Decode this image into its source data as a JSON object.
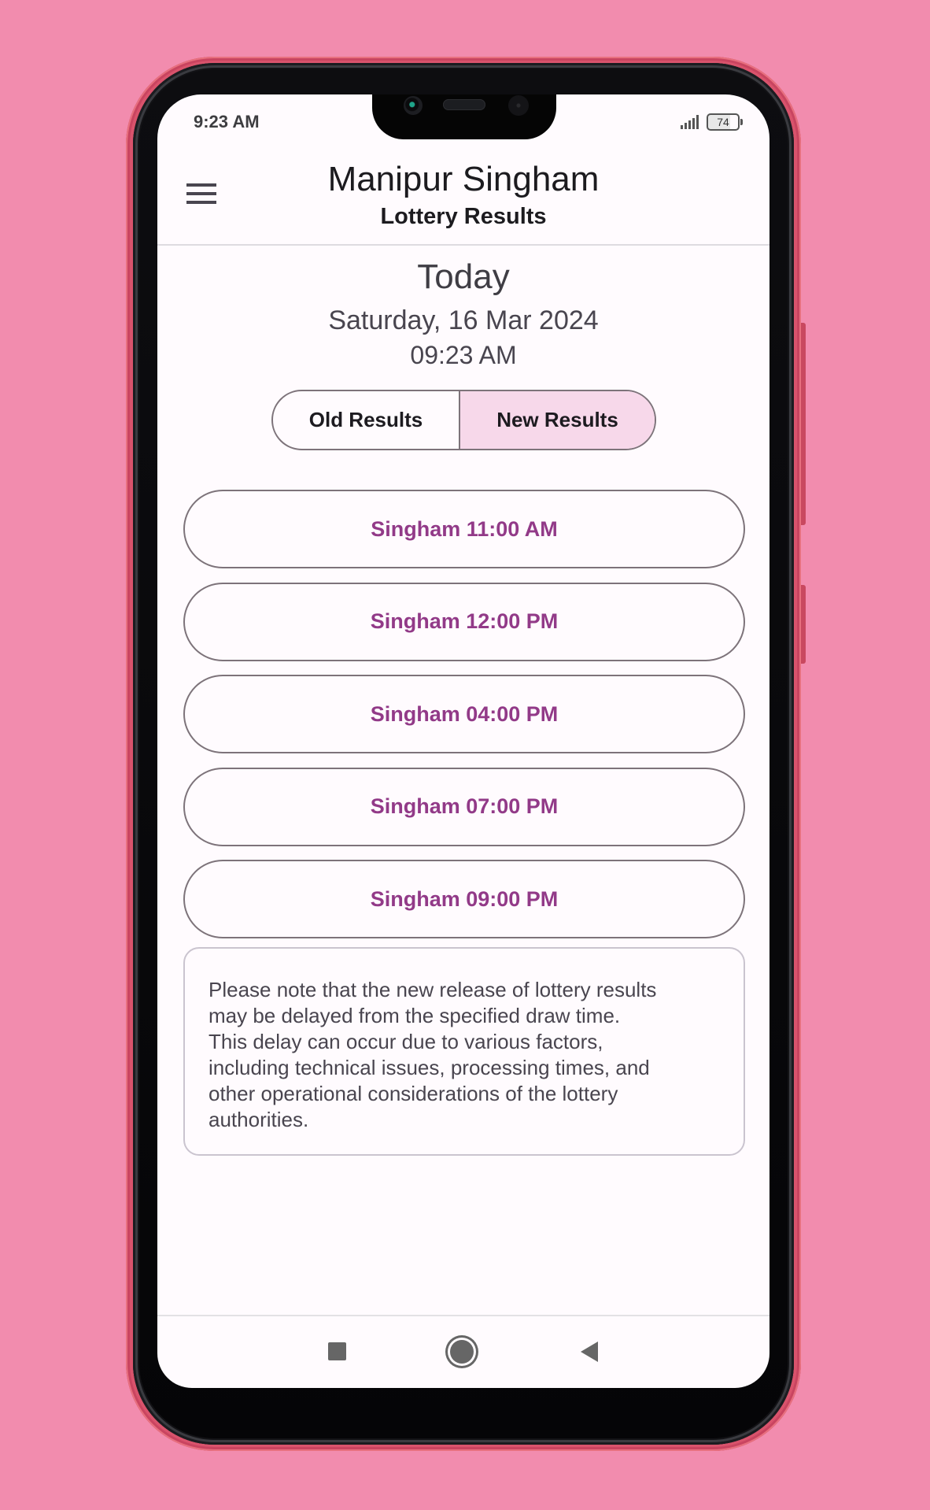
{
  "status_bar": {
    "time": "9:23 AM",
    "battery": "74",
    "signal_icon": "signal-icon",
    "battery_icon": "battery-icon"
  },
  "header": {
    "menu_icon": "hamburger-menu-icon",
    "title": "Manipur Singham",
    "subtitle": "Lottery Results"
  },
  "today": {
    "label": "Today",
    "date": "Saturday, 16 Mar 2024",
    "time": "09:23 AM"
  },
  "segmented": {
    "options": [
      {
        "label": "Old Results",
        "selected": false
      },
      {
        "label": "New Results",
        "selected": true
      }
    ]
  },
  "draws": [
    {
      "label": "Singham 11:00 AM"
    },
    {
      "label": "Singham 12:00 PM"
    },
    {
      "label": "Singham 04:00 PM"
    },
    {
      "label": "Singham 07:00 PM"
    },
    {
      "label": "Singham 09:00 PM"
    }
  ],
  "note": {
    "text": "Please note that the new release of lottery results\nmay be delayed from the specified draw time.\n This delay can occur due to various factors,\nincluding technical issues, processing times, and\nother operational considerations of the lottery\nauthorities."
  },
  "colors": {
    "background": "#f28cae",
    "accent_text": "#923a88",
    "selected_segment": "#f7d8ea",
    "outline": "#7d737a"
  },
  "nav_bar": {
    "recents_icon": "recents-square-icon",
    "home_icon": "home-circle-icon",
    "back_icon": "back-triangle-icon"
  }
}
